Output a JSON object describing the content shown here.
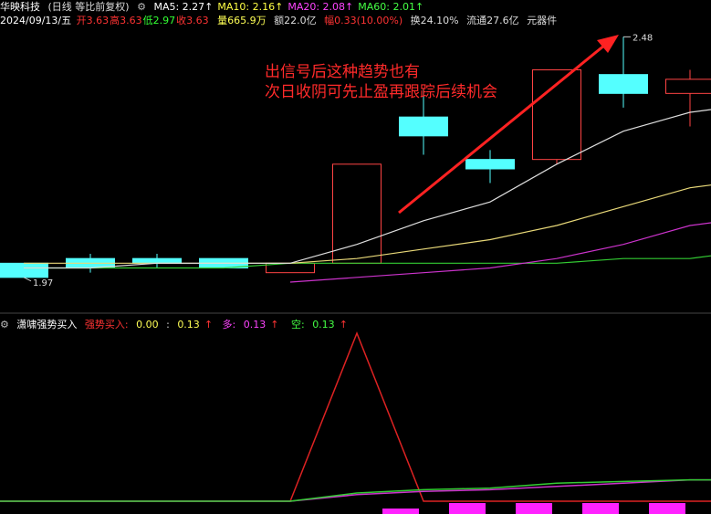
{
  "header": {
    "stock_name": "华映科技",
    "period": "(日线 等比前复权)",
    "ma": [
      {
        "label": "MA5:",
        "value": "2.27",
        "color": "#ffffff"
      },
      {
        "label": "MA10:",
        "value": "2.16",
        "color": "#ffff44"
      },
      {
        "label": "MA20:",
        "value": "2.08",
        "color": "#ff44ff"
      },
      {
        "label": "MA60:",
        "value": "2.01",
        "color": "#44ff44"
      }
    ],
    "up_arrow": "↑",
    "date": "2024/09/13/五",
    "ohlc": [
      {
        "label": "开",
        "value": "3.63",
        "color": "#ff3333"
      },
      {
        "label": "高",
        "value": "3.63",
        "color": "#ff3333"
      },
      {
        "label": "低",
        "value": "2.97",
        "color": "#33ff33"
      },
      {
        "label": "收",
        "value": "3.63",
        "color": "#ff3333"
      }
    ],
    "volume": "量665.9万",
    "amount": "额22.0亿",
    "change": "幅0.33(10.00%)",
    "turnover": "换24.10%",
    "float": "流通27.6亿",
    "sector": "元器件"
  },
  "annotation": {
    "line1": "出信号后这种趋势也有",
    "line2": "次日收阴可先止盈再跟踪后续机会"
  },
  "price_labels": {
    "high": "2.48",
    "low": "1.97"
  },
  "indicator": {
    "name": "潇啸强势买入",
    "strong_label": "强势买入:",
    "strong_v1": "0.00",
    "strong_sep": ":",
    "strong_v2": "0.13",
    "long_label": "多:",
    "long_value": "0.13",
    "short_label": "空:",
    "short_value": "0.13"
  },
  "colors": {
    "up": "#ff4444",
    "down": "#54ffff",
    "ma5": "#dddddd",
    "ma10": "#e8d878",
    "ma20": "#cc33cc",
    "ma60": "#33cc33",
    "signal": "#dd2222",
    "bar": "#ff22ff"
  },
  "chart_data": {
    "type": "candlestick",
    "price_axis_range": [
      1.9,
      2.5
    ],
    "candles": [
      {
        "open": 2.0,
        "high": 2.0,
        "low": 1.97,
        "close": 1.97
      },
      {
        "open": 2.01,
        "high": 2.02,
        "low": 1.98,
        "close": 1.99
      },
      {
        "open": 2.01,
        "high": 2.02,
        "low": 1.99,
        "close": 2.0
      },
      {
        "open": 2.01,
        "high": 2.01,
        "low": 1.99,
        "close": 1.99
      },
      {
        "open": 1.98,
        "high": 2.0,
        "low": 1.98,
        "close": 2.0
      },
      {
        "open": 2.0,
        "high": 2.21,
        "low": 2.0,
        "close": 2.21
      },
      {
        "open": 2.31,
        "high": 2.37,
        "low": 2.23,
        "close": 2.27
      },
      {
        "open": 2.22,
        "high": 2.24,
        "low": 2.17,
        "close": 2.2
      },
      {
        "open": 2.22,
        "high": 2.41,
        "low": 2.21,
        "close": 2.41
      },
      {
        "open": 2.4,
        "high": 2.48,
        "low": 2.33,
        "close": 2.36
      },
      {
        "open": 2.36,
        "high": 2.41,
        "low": 2.29,
        "close": 2.39
      }
    ],
    "ma5": [
      1.99,
      1.99,
      2.0,
      2.0,
      2.0,
      2.04,
      2.09,
      2.13,
      2.21,
      2.28,
      2.32
    ],
    "ma10": [
      2.0,
      2.0,
      2.0,
      2.0,
      2.0,
      2.01,
      2.03,
      2.05,
      2.08,
      2.12,
      2.16
    ],
    "ma20": [
      null,
      null,
      null,
      null,
      1.96,
      1.97,
      1.98,
      1.99,
      2.01,
      2.04,
      2.08
    ],
    "ma60": [
      1.99,
      1.99,
      1.99,
      1.99,
      2.0,
      2.0,
      2.0,
      2.0,
      2.0,
      2.01,
      2.01
    ],
    "indicator": {
      "signal": [
        0,
        0,
        0,
        0,
        0,
        1,
        0,
        0,
        0,
        0,
        0
      ],
      "long": [
        0.0,
        0.0,
        0.0,
        0.0,
        0.0,
        0.04,
        0.06,
        0.07,
        0.09,
        0.11,
        0.13
      ],
      "short": [
        0.0,
        0.0,
        0.0,
        0.0,
        0.0,
        0.05,
        0.07,
        0.08,
        0.11,
        0.12,
        0.13
      ],
      "bars": [
        0,
        0,
        0,
        0,
        0,
        1,
        1,
        1,
        1,
        1,
        1
      ]
    }
  }
}
